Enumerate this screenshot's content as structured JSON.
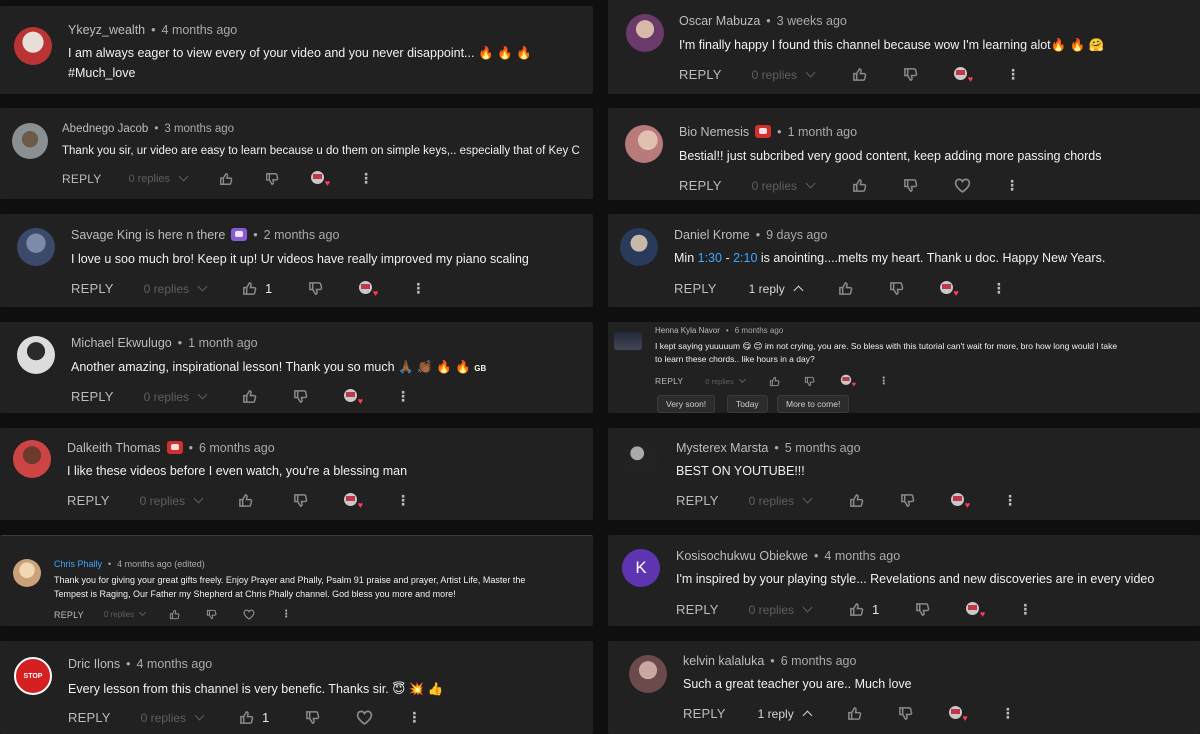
{
  "labels": {
    "reply": "REPLY",
    "more": "⋮"
  },
  "colors": {
    "background": "#0f0f0f",
    "card": "#212121",
    "timestamp_link": "#3ea6ff",
    "heart": "#ff3a55"
  },
  "icons": {
    "like": "thumbs-up-icon",
    "dislike": "thumbs-down-icon",
    "heart": "heart-outline-icon",
    "creator_heart": "creator-heart-icon",
    "more": "kebab-icon"
  },
  "comments": [
    {
      "author": "Ykeyz_wealth",
      "time": "4 months ago",
      "text": "I am always eager to view every of your video and you never disappoint...",
      "text2": "#Much_love",
      "emoji": [
        "fire",
        "fire",
        "fire"
      ],
      "replies": "",
      "likes": "",
      "avatar_color": "#b33"
    },
    {
      "author": "Abednego Jacob",
      "time": "3 months ago",
      "text": "Thank you sir, ur video are easy to learn because u do them on simple keys,.. especially that of Key C",
      "replies": "0 replies",
      "likes": "",
      "avatar_color": "#8a8f92"
    },
    {
      "author": "Savage King is here n there",
      "time": "2 months ago",
      "text": "I love u soo much bro! Keep it up! Ur videos have really improved my piano scaling",
      "replies": "0 replies",
      "likes": "1",
      "avatar_color": "#3b4a6a"
    },
    {
      "author": "Michael Ekwulugo",
      "time": "1 month ago",
      "text": "Another amazing, inspirational lesson! Thank you so much",
      "suffix": "GB",
      "replies": "0 replies",
      "likes": "",
      "avatar_color": "#dcdcdc"
    },
    {
      "author": "Dalkeith Thomas",
      "time": "6 months ago",
      "text": "I like these videos before I even watch, you're a blessing man",
      "replies": "0 replies",
      "likes": "",
      "avatar_color": "#c44"
    },
    {
      "author": "Chris Phally",
      "time": "4 months ago (edited)",
      "text": "Thank you for giving your great gifts freely. Enjoy Prayer and Phally, Psalm 91 praise and prayer, Artist Life, Master the",
      "text2": "Tempest is Raging, Our Father my Shepherd at Chris Phally channel. God bless you more and more!",
      "replies": "0 replies",
      "likes": "",
      "avatar_color": "#c9a27a"
    },
    {
      "author": "Dric Ilons",
      "time": "4 months ago",
      "text": "Every lesson from this channel is very benefic. Thanks sir.",
      "avatar_text": "STOP",
      "replies": "0 replies",
      "likes": "1",
      "avatar_color": "#d42020"
    },
    {
      "author": "Oscar Mabuza",
      "time": "3 weeks ago",
      "text": "I'm finally  happy I found this channel  because  wow  I'm learning  alot",
      "replies": "0 replies",
      "likes": "",
      "avatar_color": "#6b3a6a"
    },
    {
      "author": "Bio Nemesis",
      "time": "1 month ago",
      "text": "Bestial!! just subcribed very good content, keep adding more passing chords",
      "replies": "0 replies",
      "likes": "",
      "avatar_color": "#b87a7a"
    },
    {
      "author": "Daniel Krome",
      "time": "9 days ago",
      "text_a": "Min ",
      "ts1": "1:30",
      "text_b": " - ",
      "ts2": "2:10",
      "text_c": " is anointing....melts my heart. Thank u doc. Happy New Years.",
      "replies": "1 reply",
      "likes": "",
      "avatar_color": "#2a3a5a"
    },
    {
      "author": "Henna Kyla Navor",
      "time": "6 months ago",
      "text": "I kept saying yuuuuum",
      "text_mid": "im not crying, you are. So bless with this tutorial can't wait for more, bro how long would I take",
      "text2": "to learn these chords.. like hours in a day?",
      "replies": "0 replies",
      "likes": "",
      "avatar_color": "#222a3a",
      "chips": [
        "Very soon!",
        "Today",
        "More to come!"
      ]
    },
    {
      "author": "Mysterex Marsta",
      "time": "5 months ago",
      "text": "BEST ON YOUTUBE!!!",
      "replies": "0 replies",
      "likes": "",
      "avatar_color": "#333"
    },
    {
      "author": "Kosisochukwu Obiekwe",
      "time": "4 months ago",
      "text": "I'm inspired by your playing style... Revelations and new discoveries are in every video",
      "avatar_text": "K",
      "replies": "0 replies",
      "likes": "1",
      "avatar_color": "#5e35b1"
    },
    {
      "author": "kelvin kalaluka",
      "time": "6 months ago",
      "text": "Such a great teacher you are.. Much love",
      "replies": "1 reply",
      "likes": "",
      "avatar_color": "#6a4a4a"
    }
  ]
}
